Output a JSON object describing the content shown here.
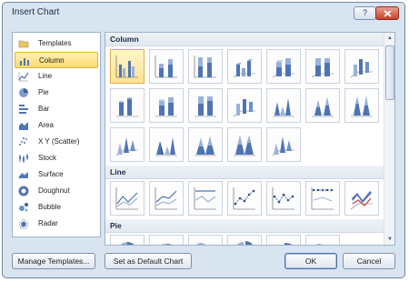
{
  "window": {
    "title": "Insert Chart",
    "help_label": "?"
  },
  "categories": [
    {
      "label": "Templates",
      "icon": "folder-icon"
    },
    {
      "label": "Column",
      "icon": "column-chart-icon",
      "selected": true
    },
    {
      "label": "Line",
      "icon": "line-chart-icon"
    },
    {
      "label": "Pie",
      "icon": "pie-chart-icon"
    },
    {
      "label": "Bar",
      "icon": "bar-chart-icon"
    },
    {
      "label": "Area",
      "icon": "area-chart-icon"
    },
    {
      "label": "X Y (Scatter)",
      "icon": "scatter-chart-icon"
    },
    {
      "label": "Stock",
      "icon": "stock-chart-icon"
    },
    {
      "label": "Surface",
      "icon": "surface-chart-icon"
    },
    {
      "label": "Doughnut",
      "icon": "doughnut-chart-icon"
    },
    {
      "label": "Bubble",
      "icon": "bubble-chart-icon"
    },
    {
      "label": "Radar",
      "icon": "radar-chart-icon"
    }
  ],
  "sections": {
    "column": "Column",
    "line": "Line",
    "pie": "Pie"
  },
  "buttons": {
    "manage_templates": "Manage Templates...",
    "set_default": "Set as Default Chart",
    "ok": "OK",
    "cancel": "Cancel"
  },
  "colors": {
    "accent": "#4f74b3",
    "selection": "#ffd86c"
  }
}
